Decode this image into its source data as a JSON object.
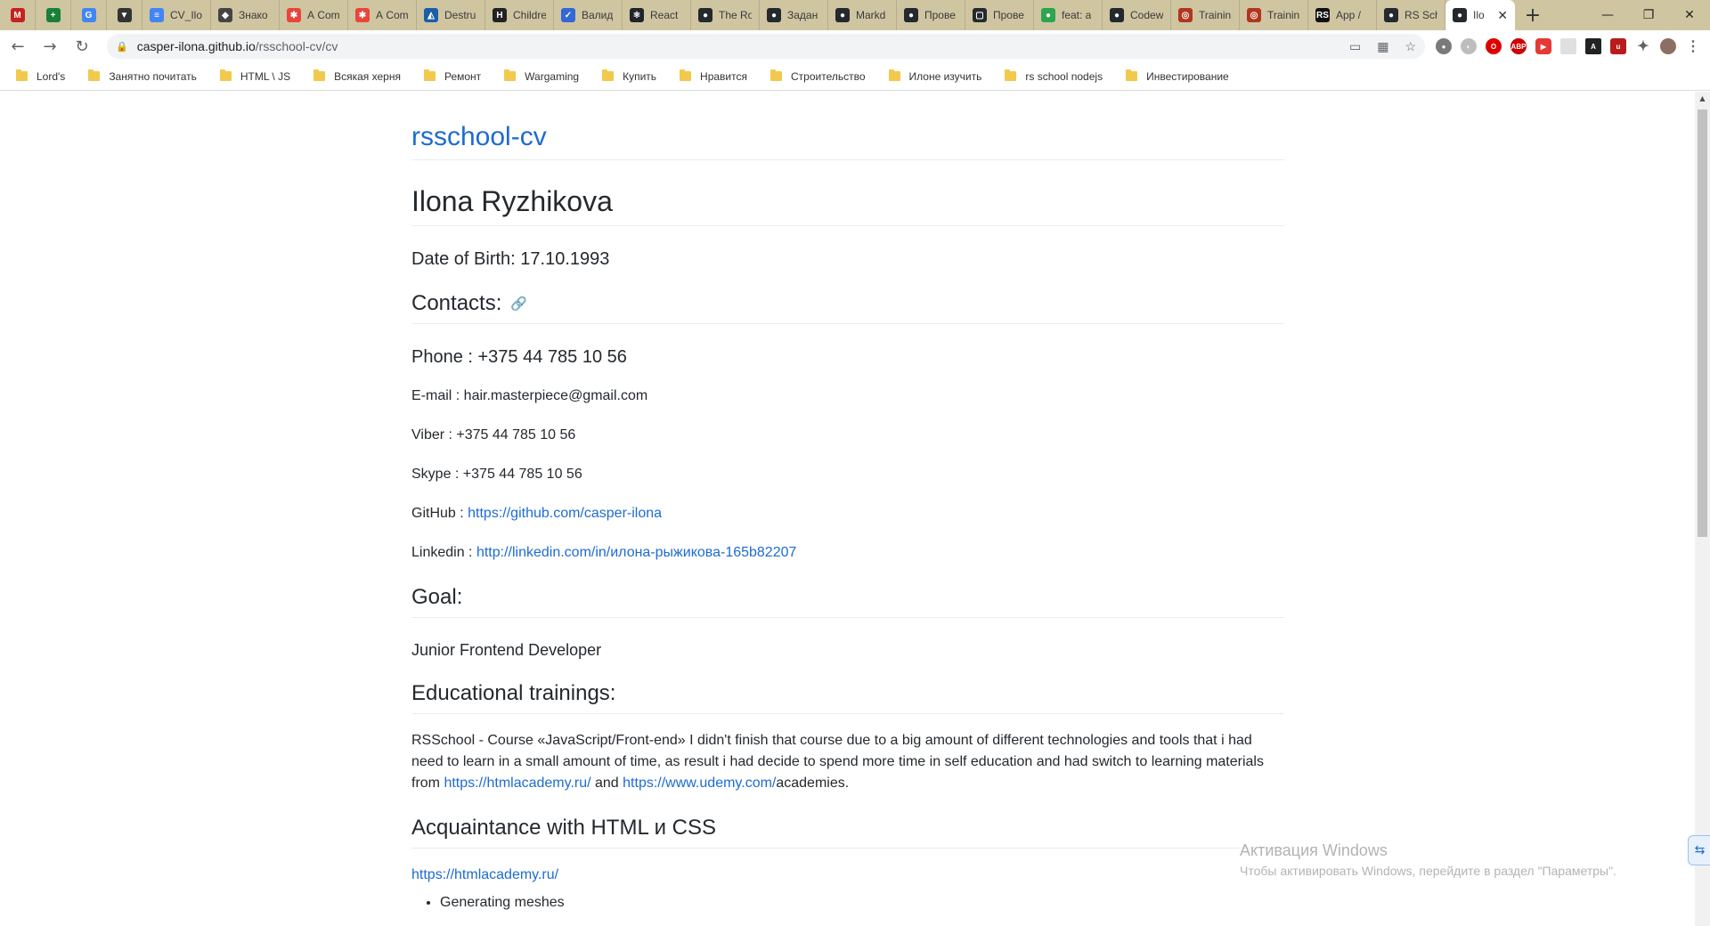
{
  "browser": {
    "tabs": [
      {
        "title": "",
        "icon": "gmail-icon",
        "color": "#c5221f",
        "glyph": "M",
        "pinned": true
      },
      {
        "title": "",
        "icon": "sheets-icon",
        "color": "#188038",
        "glyph": "+",
        "pinned": true
      },
      {
        "title": "",
        "icon": "translate-icon",
        "color": "#4285f4",
        "glyph": "G",
        "pinned": true
      },
      {
        "title": "",
        "icon": "pocket-icon",
        "color": "#333333",
        "glyph": "▼",
        "pinned": true
      },
      {
        "title": "CV_Ilo",
        "icon": "docs-icon",
        "color": "#4285f4",
        "glyph": "≡"
      },
      {
        "title": "Знако",
        "icon": "shield-icon",
        "color": "#444444",
        "glyph": "◆"
      },
      {
        "title": "А Com",
        "icon": "asterisk-icon",
        "color": "#e8453c",
        "glyph": "✱"
      },
      {
        "title": "А Com",
        "icon": "asterisk-icon",
        "color": "#e8453c",
        "glyph": "✱"
      },
      {
        "title": "Destru",
        "icon": "mdn-icon",
        "color": "#1a5ea8",
        "glyph": "◭"
      },
      {
        "title": "Childre",
        "icon": "h-icon",
        "color": "#222222",
        "glyph": "H"
      },
      {
        "title": "Валид",
        "icon": "validator-icon",
        "color": "#3367d6",
        "glyph": "✓"
      },
      {
        "title": "React",
        "icon": "react-icon",
        "color": "#20232a",
        "glyph": "⚛"
      },
      {
        "title": "The Ro",
        "icon": "github-icon",
        "color": "#24292e",
        "glyph": "●"
      },
      {
        "title": "Задан",
        "icon": "github-icon",
        "color": "#24292e",
        "glyph": "●"
      },
      {
        "title": "Markd",
        "icon": "github-icon",
        "color": "#24292e",
        "glyph": "●"
      },
      {
        "title": "Прове",
        "icon": "github-icon",
        "color": "#24292e",
        "glyph": "●"
      },
      {
        "title": "Прове",
        "icon": "chat-icon",
        "color": "#24292e",
        "glyph": "▢"
      },
      {
        "title": "feat: a",
        "icon": "github-icon",
        "color": "#2da44e",
        "glyph": "●"
      },
      {
        "title": "Codew",
        "icon": "github-icon",
        "color": "#24292e",
        "glyph": "●"
      },
      {
        "title": "Trainin",
        "icon": "codewars-icon",
        "color": "#b1361e",
        "glyph": "◎"
      },
      {
        "title": "Trainin",
        "icon": "codewars-icon",
        "color": "#b1361e",
        "glyph": "◎"
      },
      {
        "title": "App /",
        "icon": "rs-icon",
        "color": "#111111",
        "glyph": "RS"
      },
      {
        "title": "RS Sch",
        "icon": "github-icon",
        "color": "#24292e",
        "glyph": "●"
      },
      {
        "title": "Ilo",
        "icon": "github-icon",
        "color": "#24292e",
        "glyph": "●",
        "active": true
      }
    ],
    "url_host": "casper-ilona.github.io",
    "url_path": "/rsschool-cv/cv",
    "bookmarks": [
      "Lord's",
      "Занятно почитать",
      "HTML \\ JS",
      "Всякая херня",
      "Ремонт",
      "Wargaming",
      "Купить",
      "Нравится",
      "Строительство",
      "Илоне изучить",
      "rs school nodejs",
      "Инвестирование"
    ]
  },
  "page": {
    "site_title": "rsschool-cv",
    "name": "Ilona Ryzhikova",
    "dob": "Date of Birth: 17.10.1993",
    "contacts_heading": "Contacts:",
    "phone": "Phone : +375 44 785 10 56",
    "email": "E-mail : hair.masterpiece@gmail.com",
    "viber": "Viber : +375 44 785 10 56",
    "skype": "Skype : +375 44 785 10 56",
    "github_label": "GitHub : ",
    "github_url": "https://github.com/casper-ilona",
    "linkedin_label": "Linkedin : ",
    "linkedin_url": "http://linkedin.com/in/илона-рыжикова-165b82207",
    "goal_heading": "Goal:",
    "goal": "Junior Frontend Developer",
    "edu_heading": "Educational trainings:",
    "edu_text": "RSSchool - Course «JavaScript/Front-end» I didn't finish that course due to a big amount of different technologies and tools that i had need to learn in a small amount of time, as result i had decide to spend more time in self education and had switch to learning materials from ",
    "edu_link1": "https://htmlacademy.ru/",
    "edu_and": " and ",
    "edu_link2": "https://www.udemy.com/",
    "edu_tail": "academies.",
    "html_heading": "Acquaintance with HTML и CSS",
    "html_link": "https://htmlacademy.ru/",
    "html_items": [
      "Generating meshes"
    ]
  },
  "watermark": {
    "line1": "Активация Windows",
    "line2": "Чтобы активировать Windows, перейдите в раздел \"Параметры\"."
  }
}
